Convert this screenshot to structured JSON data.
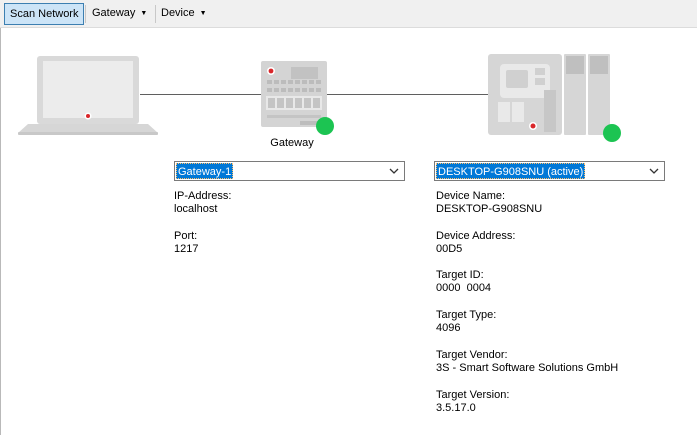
{
  "toolbar": {
    "scan_label": "Scan Network",
    "gateway_menu_label": "Gateway",
    "device_menu_label": "Device"
  },
  "topology": {
    "gateway_caption": "Gateway",
    "status_colors": {
      "online": "#1cc452"
    }
  },
  "gateway_panel": {
    "selected": "Gateway-1",
    "fields": [
      {
        "label": "IP-Address:",
        "value": "localhost"
      },
      {
        "label": "Port:",
        "value": "1217"
      }
    ]
  },
  "device_panel": {
    "selected": "DESKTOP-G908SNU (active)",
    "fields": [
      {
        "label": "Device Name:",
        "value": "DESKTOP-G908SNU"
      },
      {
        "label": "Device Address:",
        "value": "00D5"
      },
      {
        "label": "Target ID:",
        "value": "0000  0004"
      },
      {
        "label": "Target Type:",
        "value": "4096"
      },
      {
        "label": "Target Vendor:",
        "value": "3S - Smart Software Solutions GmbH"
      },
      {
        "label": "Target Version:",
        "value": "3.5.17.0"
      }
    ]
  }
}
